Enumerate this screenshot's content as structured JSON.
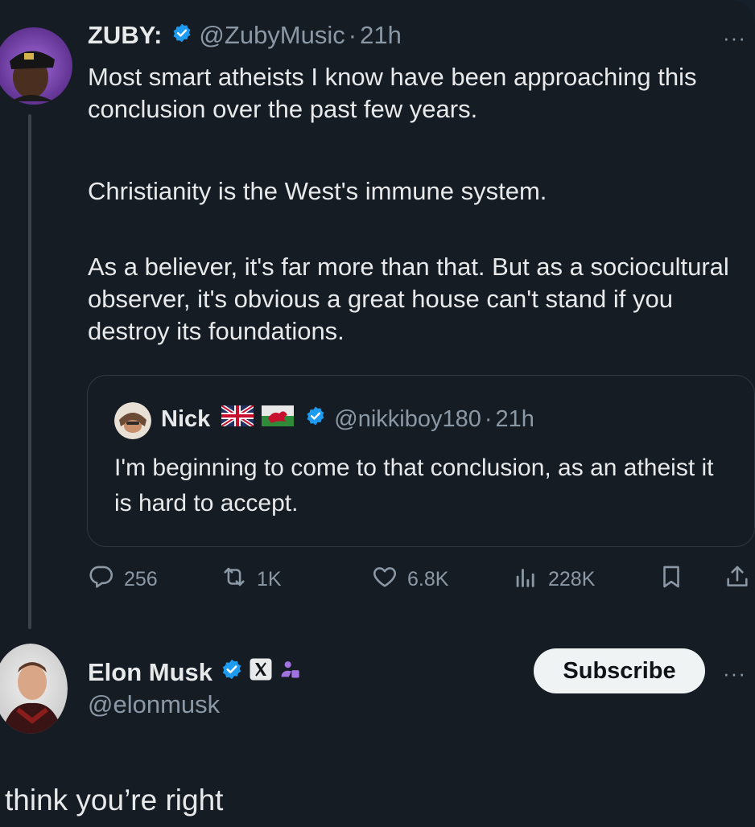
{
  "main_tweet": {
    "display_name": "ZUBY:",
    "handle": "@ZubyMusic",
    "separator": "·",
    "time": "21h",
    "paragraphs": [
      "Most smart atheists I know have been approaching this conclusion over the past few years.",
      "Christianity is the West's immune system.",
      "As a believer, it's far more than that. But as a sociocultural observer, it's obvious a great house can't stand if you destroy its foundations."
    ]
  },
  "quoted_tweet": {
    "display_name": "Nick",
    "handle": "@nikkiboy180",
    "separator": "·",
    "time": "21h",
    "text": "I'm beginning to come to that conclusion, as an atheist it is hard to accept."
  },
  "actions": {
    "replies": "256",
    "reposts": "1K",
    "likes": "6.8K",
    "views": "228K"
  },
  "reply_author": {
    "display_name": "Elon Musk",
    "handle": "@elonmusk",
    "subscribe_label": "Subscribe"
  },
  "reply_text": "think you’re right",
  "more_label": "···",
  "colors": {
    "background": "#161c24",
    "verified": "#1d9bf0",
    "text": "#e7e9ea",
    "muted": "#8b98a5"
  },
  "icons": [
    "reply-icon",
    "repost-icon",
    "like-icon",
    "views-icon",
    "bookmark-icon",
    "share-icon",
    "verified-icon",
    "x-affiliate-icon",
    "parody-badge-icon",
    "uk-flag-icon",
    "wales-flag-icon"
  ]
}
